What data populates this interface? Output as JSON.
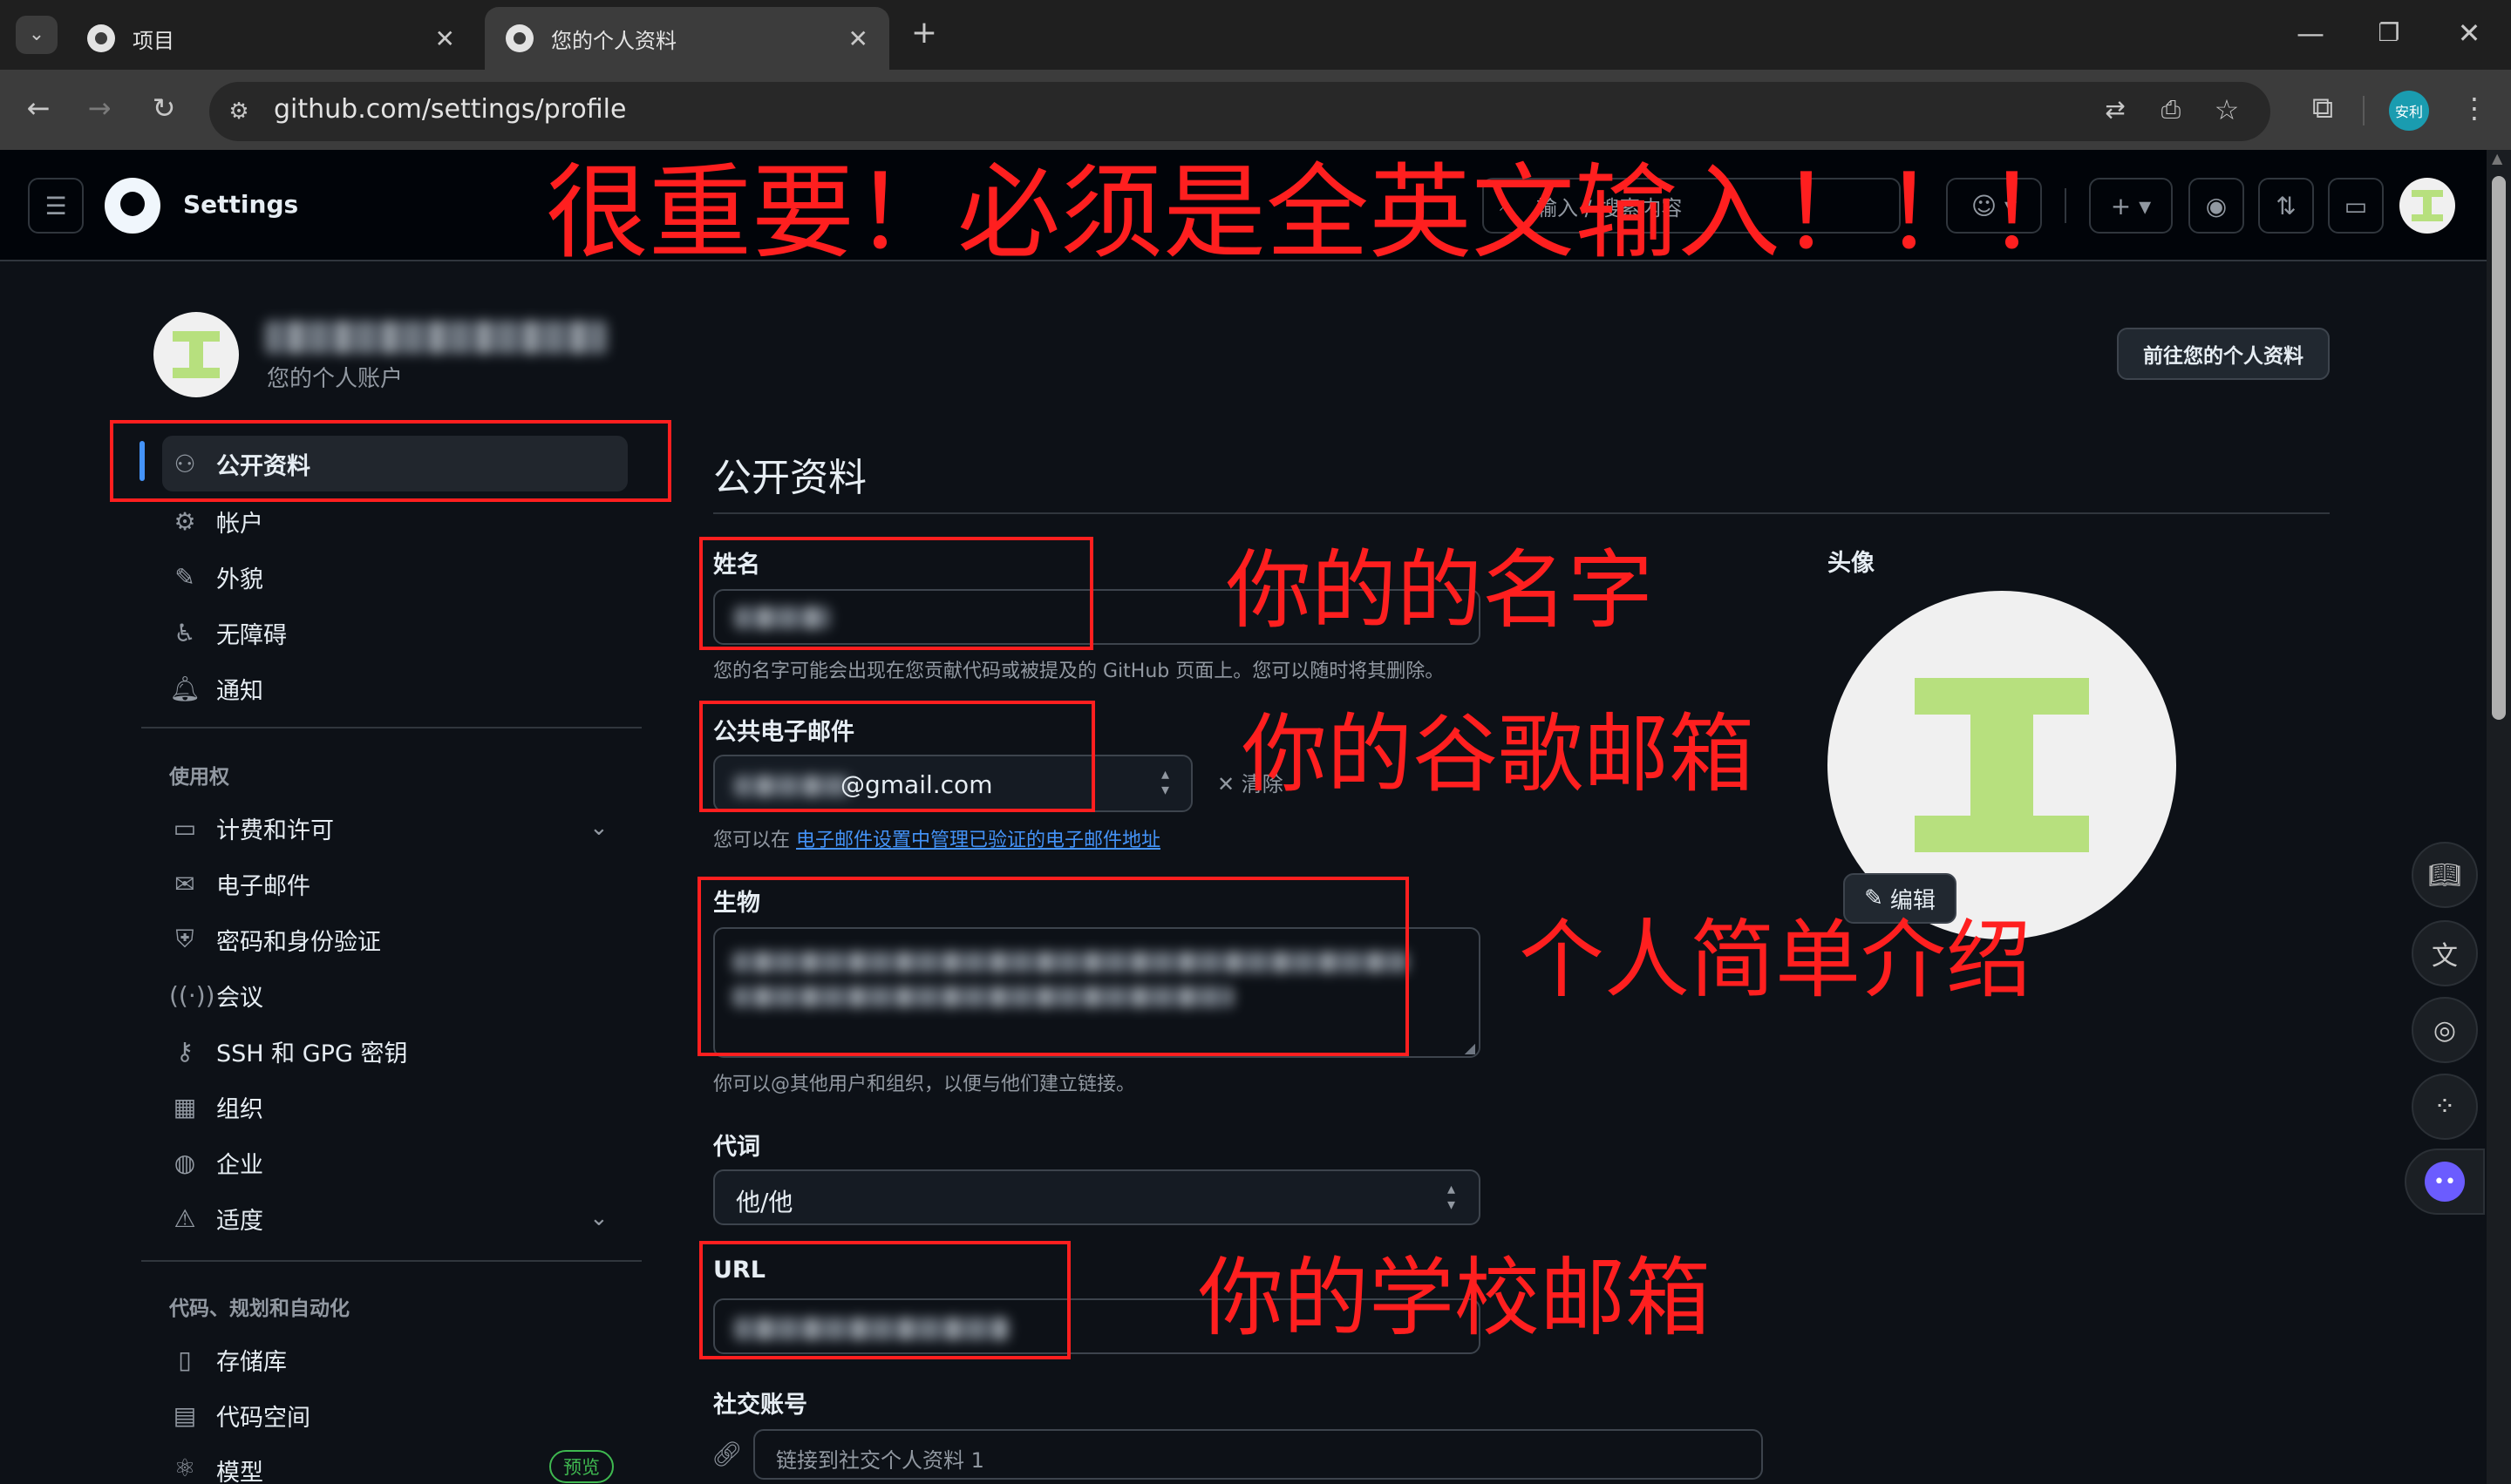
{
  "browser": {
    "tabs": [
      {
        "title": "项目",
        "active": false
      },
      {
        "title": "您的个人资料",
        "active": true
      }
    ],
    "url": "github.com/settings/profile",
    "profile_badge": "安利"
  },
  "header": {
    "title": "Settings",
    "search_placeholder": "输入 / 搜索内容",
    "search_key": "/"
  },
  "account": {
    "subtitle": "您的个人账户",
    "goto_profile_button": "前往您的个人资料"
  },
  "sidebar": {
    "items_top": [
      {
        "label": "公开资料",
        "icon": "person-icon"
      },
      {
        "label": "帐户",
        "icon": "gear-icon"
      },
      {
        "label": "外貌",
        "icon": "paintbrush-icon"
      },
      {
        "label": "无障碍",
        "icon": "accessibility-icon"
      },
      {
        "label": "通知",
        "icon": "bell-icon"
      }
    ],
    "section_access": "使用权",
    "items_access": [
      {
        "label": "计费和许可",
        "icon": "credit-card-icon"
      },
      {
        "label": "电子邮件",
        "icon": "mail-icon"
      },
      {
        "label": "密码和身份验证",
        "icon": "shield-lock-icon"
      },
      {
        "label": "会议",
        "icon": "broadcast-icon"
      },
      {
        "label": "SSH 和 GPG 密钥",
        "icon": "key-icon"
      },
      {
        "label": "组织",
        "icon": "organization-icon"
      },
      {
        "label": "企业",
        "icon": "globe-icon"
      },
      {
        "label": "适度",
        "icon": "report-icon"
      }
    ],
    "section_code": "代码、规划和自动化",
    "items_code": [
      {
        "label": "存储库",
        "icon": "repo-icon"
      },
      {
        "label": "代码空间",
        "icon": "codespaces-icon"
      },
      {
        "label": "模型",
        "icon": "model-icon",
        "badge": "预览"
      }
    ]
  },
  "main": {
    "heading": "公开资料",
    "name_label": "姓名",
    "name_note": "您的名字可能会出现在您贡献代码或被提及的 GitHub 页面上。您可以随时将其删除。",
    "email_label": "公共电子邮件",
    "email_value": "@gmail.com",
    "email_clear": "清除",
    "email_note_prefix": "您可以在",
    "email_note_link": "电子邮件设置中管理已验证的电子邮件地址",
    "bio_label": "生物",
    "bio_note": "你可以@其他用户和组织，以便与他们建立链接。",
    "pronouns_label": "代词",
    "pronouns_value": "他/他",
    "url_label": "URL",
    "social_label": "社交账号",
    "social_placeholder": "链接到社交个人资料 1",
    "avatar_label": "头像",
    "avatar_edit": "编辑"
  },
  "annotations": {
    "top": "很重要！必须是全英文输入！！！",
    "name": "你的的名字",
    "email": "你的谷歌邮箱",
    "bio": "个人简单介绍",
    "url": "你的学校邮箱"
  },
  "colors": {
    "accent_blue": "#4493f8",
    "annotation_red": "#ff1f1f",
    "avatar_green": "#b7e07e",
    "badge_green": "#3fb950"
  }
}
